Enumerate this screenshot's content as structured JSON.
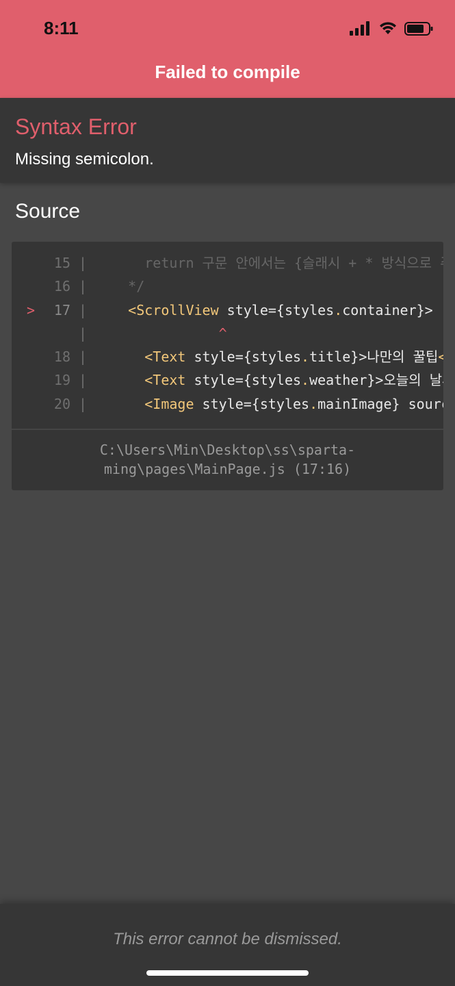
{
  "status_bar": {
    "time": "8:11"
  },
  "header": {
    "title": "Failed to compile"
  },
  "error": {
    "title": "Syntax Error",
    "message": "Missing semicolon."
  },
  "source": {
    "heading": "Source",
    "lines": [
      {
        "marker": "",
        "number": "15",
        "sep": "|",
        "parts": [
          {
            "t": "      return 구문 안에서는 {슬래시 + * 방식으로 주석",
            "c": "dim"
          }
        ]
      },
      {
        "marker": "",
        "number": "16",
        "sep": "|",
        "parts": [
          {
            "t": "    */",
            "c": "dim"
          }
        ]
      },
      {
        "marker": ">",
        "number": "17",
        "sep": "|",
        "parts": [
          {
            "t": "    ",
            "c": ""
          },
          {
            "t": "<ScrollView",
            "c": "tag"
          },
          {
            "t": " style={styles",
            "c": ""
          },
          {
            "t": ".",
            "c": "tag"
          },
          {
            "t": "container}>",
            "c": ""
          }
        ]
      },
      {
        "marker": "",
        "number": "",
        "sep": "|",
        "parts": [
          {
            "t": "               ",
            "c": ""
          },
          {
            "t": "^",
            "c": "caret"
          }
        ]
      },
      {
        "marker": "",
        "number": "18",
        "sep": "|",
        "parts": [
          {
            "t": "      ",
            "c": ""
          },
          {
            "t": "<Text",
            "c": "tag"
          },
          {
            "t": " style={styles",
            "c": ""
          },
          {
            "t": ".",
            "c": "tag"
          },
          {
            "t": "title}>나만의 꿀팁",
            "c": ""
          },
          {
            "t": "<",
            "c": "tag"
          }
        ]
      },
      {
        "marker": "",
        "number": "19",
        "sep": "|",
        "parts": [
          {
            "t": "      ",
            "c": ""
          },
          {
            "t": "<Text",
            "c": "tag"
          },
          {
            "t": " style={styles",
            "c": ""
          },
          {
            "t": ".",
            "c": "tag"
          },
          {
            "t": "weather}>오늘의 날씨",
            "c": ""
          }
        ]
      },
      {
        "marker": "",
        "number": "20",
        "sep": "|",
        "parts": [
          {
            "t": "      ",
            "c": ""
          },
          {
            "t": "<Image",
            "c": "tag"
          },
          {
            "t": " style={styles",
            "c": ""
          },
          {
            "t": ".",
            "c": "tag"
          },
          {
            "t": "mainImage} source",
            "c": ""
          }
        ]
      }
    ],
    "file_path_line1": "C:\\Users\\Min\\Desktop\\ss\\sparta-",
    "file_path_line2": "ming\\pages\\MainPage.js (17:16)"
  },
  "footer": {
    "message": "This error cannot be dismissed."
  }
}
